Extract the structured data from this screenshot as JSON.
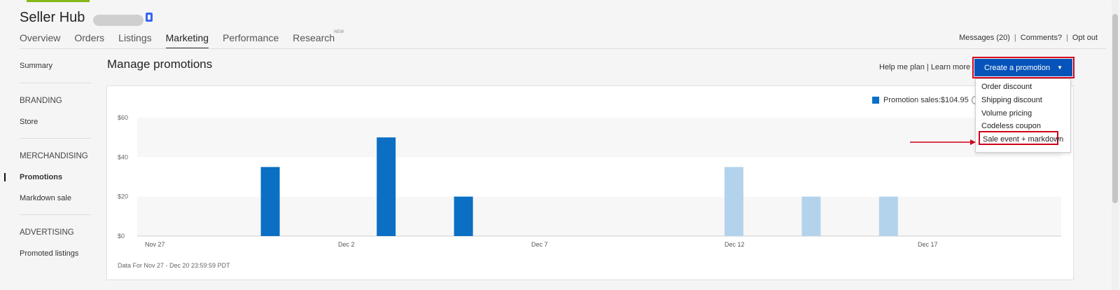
{
  "app": {
    "title": "Seller Hub",
    "accent": "#0654ba",
    "brand_stripe": "#86b817"
  },
  "nav": {
    "tabs": [
      {
        "label": "Overview"
      },
      {
        "label": "Orders"
      },
      {
        "label": "Listings"
      },
      {
        "label": "Marketing"
      },
      {
        "label": "Performance"
      },
      {
        "label": "Research",
        "badge": "NEW"
      }
    ],
    "active_tab": "Marketing",
    "links": {
      "messages": "Messages (20)",
      "comments": "Comments?",
      "optout": "Opt out"
    }
  },
  "sidebar": {
    "summary": "Summary",
    "branding_header": "BRANDING",
    "store": "Store",
    "merch_header": "MERCHANDISING",
    "promotions": "Promotions",
    "markdown": "Markdown sale",
    "adv_header": "ADVERTISING",
    "promoted": "Promoted listings"
  },
  "main": {
    "heading": "Manage promotions",
    "help_link": "Help me plan",
    "learn_link": "Learn more",
    "create_button": "Create a promotion",
    "dropdown": [
      "Order discount",
      "Shipping discount",
      "Volume pricing",
      "Codeless coupon",
      "Sale event + markdown"
    ],
    "highlight": "#d0021b",
    "footnote": "Data For Nov 27 - Dec 20 23:59:59 PDT"
  },
  "chart_data": {
    "type": "bar",
    "legend": "Promotion sales:$104.95",
    "ylim": [
      0,
      60
    ],
    "y_ticks": [
      "$0",
      "$20",
      "$40",
      "$60"
    ],
    "x_ticks": [
      {
        "label": "Nov 27",
        "day": 0
      },
      {
        "label": "Dec 2",
        "day": 5
      },
      {
        "label": "Dec 7",
        "day": 10
      },
      {
        "label": "Dec 12",
        "day": 15
      },
      {
        "label": "Dec 17",
        "day": 20
      }
    ],
    "bars": [
      {
        "day": 3,
        "value": 35,
        "past": true
      },
      {
        "day": 6,
        "value": 50,
        "past": true
      },
      {
        "day": 8,
        "value": 20,
        "past": true
      },
      {
        "day": 15,
        "value": 35,
        "past": false
      },
      {
        "day": 17,
        "value": 20,
        "past": false
      },
      {
        "day": 19,
        "value": 20,
        "past": false
      }
    ],
    "colors": {
      "past": "#0b6fc4",
      "future": "#b3d3ec"
    }
  }
}
